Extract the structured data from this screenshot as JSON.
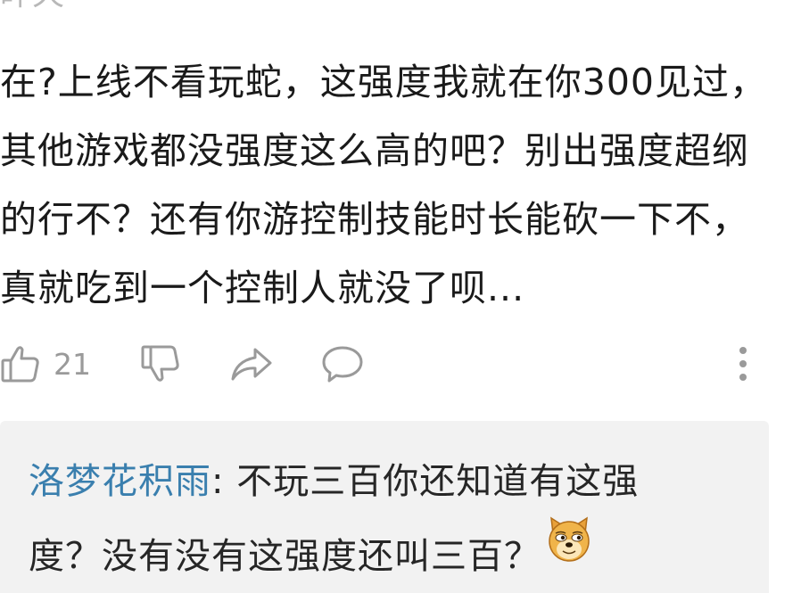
{
  "comment": {
    "timestamp": "昨天",
    "body": "在?上线不看玩蛇，这强度我就在你300见过，其他游戏都没强度这么高的吧？别出强度超纲的行不？还有你游控制技能时长能砍一下不，真就吃到一个控制人就没了呗..."
  },
  "actions": {
    "like_count": "21",
    "like_icon": "thumbs-up-icon",
    "dislike_icon": "thumbs-down-icon",
    "share_icon": "share-icon",
    "reply_icon": "comment-bubble-icon",
    "more_icon": "more-vertical-icon"
  },
  "reply": {
    "username": "洛梦花积雨",
    "separator": ": ",
    "text": "不玩三百你还知道有这强度？没有没有这强度还叫三百？",
    "emoji": "doge-emoji"
  },
  "colors": {
    "username": "#3a7fae",
    "reply_background": "#f2f2f2",
    "icon": "#9a9a9a"
  }
}
